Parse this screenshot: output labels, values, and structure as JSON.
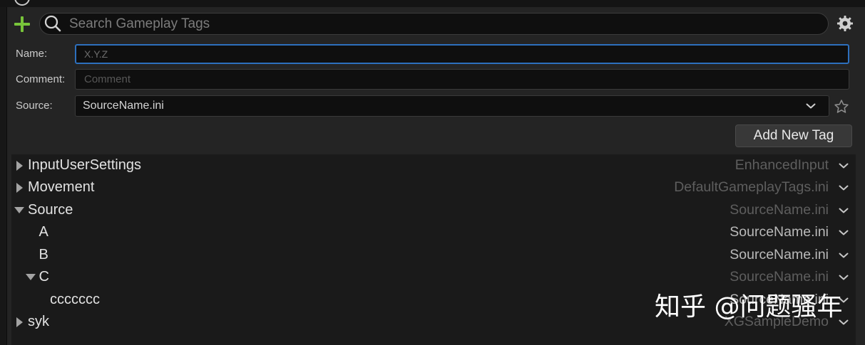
{
  "window": {
    "tab_icon": "circle-icon"
  },
  "toolbar": {
    "add_icon": "plus-icon",
    "search_icon": "search-icon",
    "search_placeholder": "Search Gameplay Tags",
    "settings_icon": "gear-icon"
  },
  "form": {
    "name_label": "Name:",
    "name_placeholder": "X.Y.Z",
    "comment_label": "Comment:",
    "comment_placeholder": "Comment",
    "source_label": "Source:",
    "source_value": "SourceName.ini",
    "source_dropdown_icon": "chevron-down-icon",
    "favorite_icon": "star-icon",
    "add_button_label": "Add New Tag"
  },
  "tree": {
    "row_menu_icon": "chevron-down-icon",
    "rows": [
      {
        "name": "InputUserSettings",
        "source": "EnhancedInput",
        "depth": 0,
        "expanded": false,
        "expander_icon": "caret-right-icon",
        "source_dimmed": true
      },
      {
        "name": "Movement",
        "source": "DefaultGameplayTags.ini",
        "depth": 0,
        "expanded": false,
        "expander_icon": "caret-right-icon",
        "source_dimmed": true
      },
      {
        "name": "Source",
        "source": "SourceName.ini",
        "depth": 0,
        "expanded": true,
        "expander_icon": "caret-down-icon",
        "source_dimmed": true
      },
      {
        "name": "A",
        "source": "SourceName.ini",
        "depth": 1,
        "expander_icon": null,
        "source_dimmed": false
      },
      {
        "name": "B",
        "source": "SourceName.ini",
        "depth": 1,
        "expander_icon": null,
        "source_dimmed": false
      },
      {
        "name": "C",
        "source": "SourceName.ini",
        "depth": 1,
        "expanded": true,
        "expander_icon": "caret-down-icon",
        "source_dimmed": true
      },
      {
        "name": "ccccccc",
        "source": "SourceName.ini",
        "depth": 2,
        "expander_icon": null,
        "source_dimmed": false
      },
      {
        "name": "syk",
        "source": "XGSampleDemo",
        "depth": 0,
        "expanded": false,
        "expander_icon": "caret-right-icon",
        "source_dimmed": true
      }
    ]
  },
  "watermark": "知乎 @问题骚年",
  "colors": {
    "add_icon": "#78c43a",
    "focus_border": "#2d6fbd",
    "panel_bg": "#242424",
    "list_bg": "#1a1a1a"
  }
}
